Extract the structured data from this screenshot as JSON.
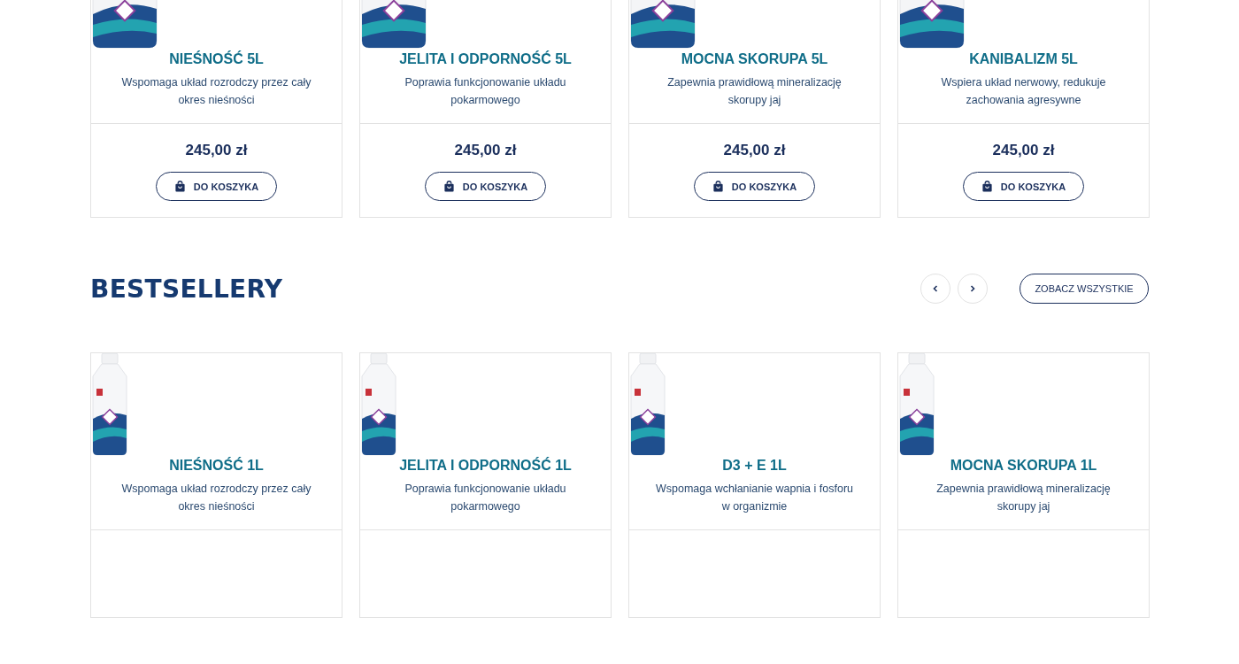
{
  "top_products": [
    {
      "kind": "canister",
      "name": "NIEŚNOŚĆ 5L",
      "description": "Wspomaga układ rozrodczy przez cały okres nieśności",
      "price": "245,00 zł",
      "button": "DO KOSZYKA"
    },
    {
      "kind": "canister",
      "name": "JELITA I ODPORNOŚĆ 5L",
      "description": "Poprawia funkcjonowanie układu pokarmowego",
      "price": "245,00 zł",
      "button": "DO KOSZYKA"
    },
    {
      "kind": "canister",
      "name": "MOCNA SKORUPA 5L",
      "description": "Zapewnia prawidłową mineralizację skorupy jaj",
      "price": "245,00 zł",
      "button": "DO KOSZYKA"
    },
    {
      "kind": "canister",
      "name": "KANIBALIZM 5L",
      "description": "Wspiera układ nerwowy, redukuje zachowania agresywne",
      "price": "245,00 zł",
      "button": "DO KOSZYKA"
    }
  ],
  "bestsellers": {
    "title": "BESTSELLERY",
    "see_all": "ZOBACZ WSZYSTKIE",
    "products": [
      {
        "kind": "bottle",
        "name": "NIEŚNOŚĆ 1L",
        "description": "Wspomaga układ rozrodczy przez cały okres nieśności"
      },
      {
        "kind": "bottle",
        "name": "JELITA I ODPORNOŚĆ 1L",
        "description": "Poprawia funkcjonowanie układu pokarmowego"
      },
      {
        "kind": "bottle",
        "name": "D3 + E 1L",
        "description": "Wspomaga wchłanianie wapnia i fosforu w organizmie"
      },
      {
        "kind": "bottle",
        "name": "MOCNA SKORUPA 1L",
        "description": "Zapewnia prawidłową mineralizację skorupy jaj"
      }
    ]
  }
}
